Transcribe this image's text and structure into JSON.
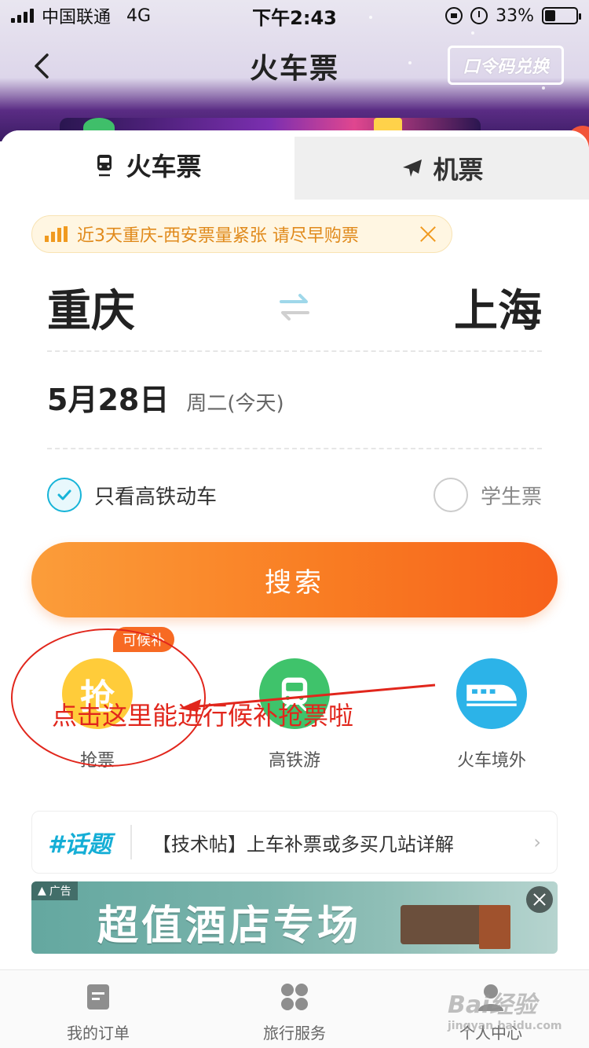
{
  "status_bar": {
    "carrier": "中国联通",
    "network": "4G",
    "time": "下午2:43",
    "battery": "33%"
  },
  "nav": {
    "title": "火车票",
    "code_exchange": "口令码兑换"
  },
  "tabs": [
    {
      "label": "火车票",
      "active": true
    },
    {
      "label": "机票",
      "active": false
    }
  ],
  "notice": {
    "text": "近3天重庆-西安票量紧张 请尽早购票"
  },
  "route": {
    "from": "重庆",
    "to": "上海"
  },
  "date": {
    "main": "5月28日",
    "sub": "周二(今天)"
  },
  "options": {
    "high_speed_only": {
      "label": "只看高铁动车",
      "checked": true
    },
    "student": {
      "label": "学生票",
      "checked": false
    }
  },
  "search_button": "搜索",
  "shortcuts": [
    {
      "label": "抢票",
      "icon": "grab-ticket-icon",
      "glyph": "抢",
      "badge": "可候补"
    },
    {
      "label": "高铁游",
      "icon": "high-speed-rail-trip-icon"
    },
    {
      "label": "火车境外",
      "icon": "overseas-train-icon"
    }
  ],
  "annotation": {
    "text": "点击这里能进行候补抢票啦"
  },
  "topic": {
    "tag": "#话题",
    "text": "【技术帖】上车补票或多买几站详解"
  },
  "ad": {
    "tag": "广告",
    "title": "超值酒店专场"
  },
  "tabbar": [
    {
      "label": "我的订单",
      "icon": "orders-icon"
    },
    {
      "label": "旅行服务",
      "icon": "travel-service-icon"
    },
    {
      "label": "个人中心",
      "icon": "profile-icon"
    }
  ],
  "watermark": {
    "text": "Bai经验",
    "sub": "jingyan.baidu.com"
  },
  "colors": {
    "accent_orange": "#f97d23",
    "accent_teal": "#16b4d8",
    "annotation_red": "#e1261c"
  }
}
